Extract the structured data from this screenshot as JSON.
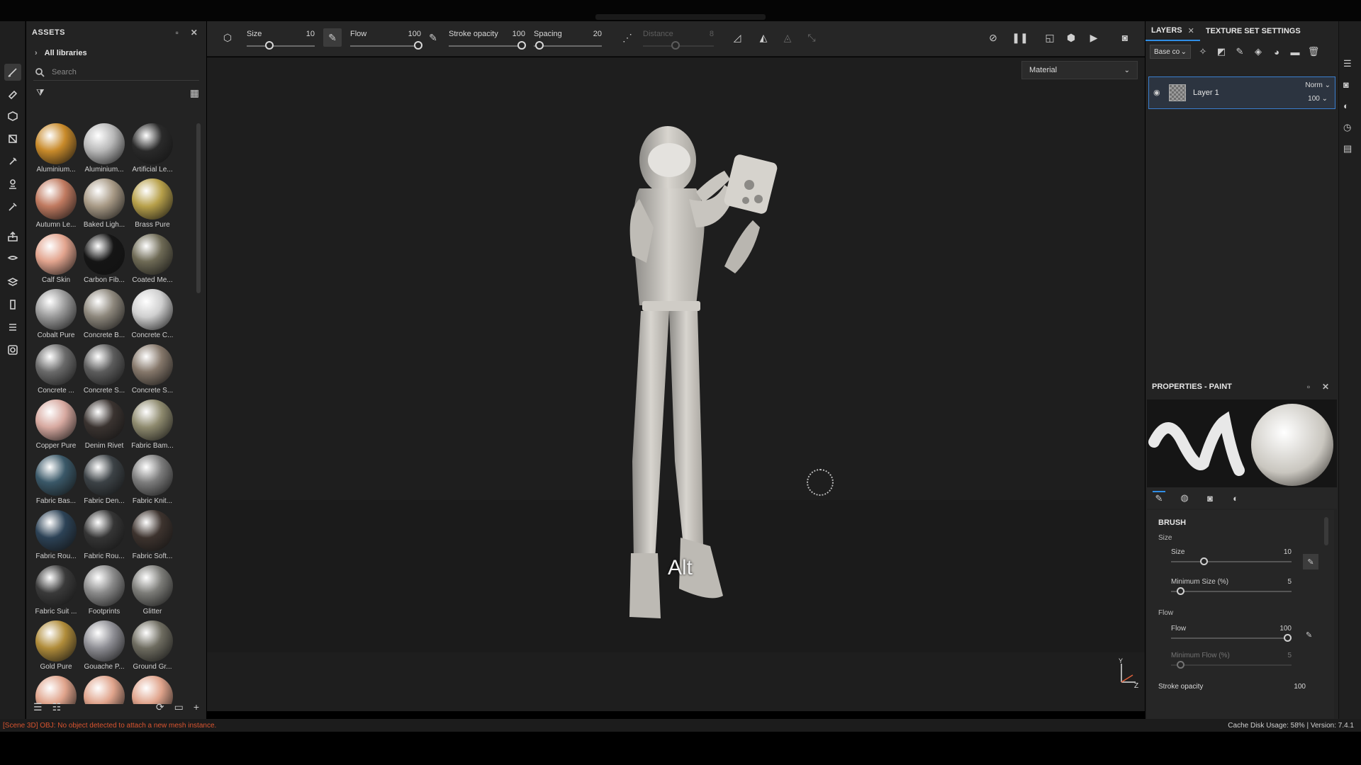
{
  "assets": {
    "title": "ASSETS",
    "library": "All libraries",
    "search_placeholder": "Search",
    "items": [
      {
        "label": "Aluminium...",
        "color": "#c88a2a"
      },
      {
        "label": "Aluminium...",
        "color": "#b8b8b8"
      },
      {
        "label": "Artificial Le...",
        "color": "#2a2a2a"
      },
      {
        "label": "Autumn Le...",
        "color": "#c07a60"
      },
      {
        "label": "Baked Ligh...",
        "color": "#a89a86"
      },
      {
        "label": "Brass Pure",
        "color": "#b7a04a"
      },
      {
        "label": "Calf Skin",
        "color": "#e2a48e"
      },
      {
        "label": "Carbon Fib...",
        "color": "#151515"
      },
      {
        "label": "Coated Me...",
        "color": "#6e6a55"
      },
      {
        "label": "Cobalt Pure",
        "color": "#9a9a9a"
      },
      {
        "label": "Concrete B...",
        "color": "#8d877c"
      },
      {
        "label": "Concrete C...",
        "color": "#cfcfcf"
      },
      {
        "label": "Concrete ...",
        "color": "#6a6a6a"
      },
      {
        "label": "Concrete S...",
        "color": "#5c5c5c"
      },
      {
        "label": "Concrete S...",
        "color": "#85776a"
      },
      {
        "label": "Copper Pure",
        "color": "#d7a9a0"
      },
      {
        "label": "Denim Rivet",
        "color": "#3a3330"
      },
      {
        "label": "Fabric Bam...",
        "color": "#8e8a6e"
      },
      {
        "label": "Fabric Bas...",
        "color": "#3a5868"
      },
      {
        "label": "Fabric Den...",
        "color": "#3c4246"
      },
      {
        "label": "Fabric Knit...",
        "color": "#7c7c7c"
      },
      {
        "label": "Fabric Rou...",
        "color": "#2c4256"
      },
      {
        "label": "Fabric Rou...",
        "color": "#353535"
      },
      {
        "label": "Fabric Soft...",
        "color": "#3d332e"
      },
      {
        "label": "Fabric Suit ...",
        "color": "#3a3a3a"
      },
      {
        "label": "Footprints",
        "color": "#8a8a8a"
      },
      {
        "label": "Glitter",
        "color": "#7c7c78"
      },
      {
        "label": "Gold Pure",
        "color": "#b08c3a"
      },
      {
        "label": "Gouache P...",
        "color": "#8e8e94"
      },
      {
        "label": "Ground Gr...",
        "color": "#6e6c60"
      },
      {
        "label": "",
        "color": "#e0a48c"
      },
      {
        "label": "",
        "color": "#e0a48c"
      },
      {
        "label": "",
        "color": "#e0a48c"
      }
    ]
  },
  "toolbar": {
    "size_label": "Size",
    "size_value": "10",
    "flow_label": "Flow",
    "flow_value": "100",
    "stroke_label": "Stroke opacity",
    "stroke_value": "100",
    "spacing_label": "Spacing",
    "spacing_value": "20",
    "distance_label": "Distance",
    "distance_value": "8"
  },
  "viewport": {
    "mode": "Material",
    "overlay_key": "Alt"
  },
  "layers": {
    "tab_layers": "LAYERS",
    "tab_texture": "TEXTURE SET SETTINGS",
    "channel": "Base co",
    "layer_name": "Layer 1",
    "blend": "Norm",
    "opacity": "100"
  },
  "properties": {
    "title": "PROPERTIES - PAINT",
    "section": "BRUSH",
    "size_group": "Size",
    "size_label": "Size",
    "size_value": "10",
    "size_level": 0.26,
    "minsize_label": "Minimum Size (%)",
    "minsize_value": "5",
    "minsize_level": 0.05,
    "flow_group": "Flow",
    "flow_label": "Flow",
    "flow_value": "100",
    "flow_level": 1.0,
    "minflow_label": "Minimum Flow (%)",
    "minflow_value": "5",
    "minflow_level": 0.05,
    "stroke_label": "Stroke opacity",
    "stroke_value": "100"
  },
  "status": {
    "error": "[Scene 3D] OBJ: No object detected to attach a new mesh instance.",
    "right": "Cache Disk Usage:    58% | Version: 7.4.1"
  }
}
